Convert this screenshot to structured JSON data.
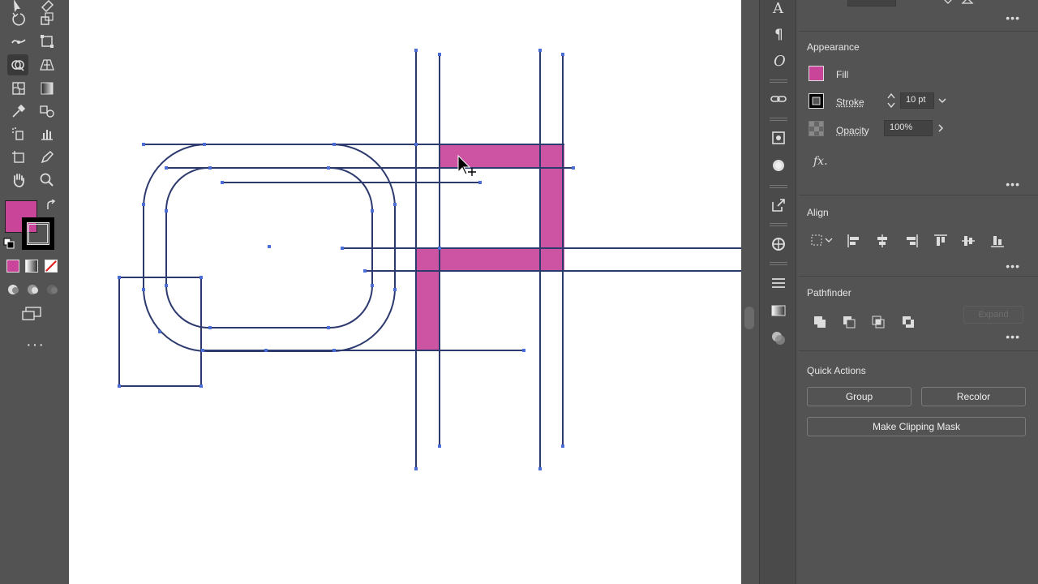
{
  "toolbar": {
    "colors": {
      "fill": "#c8459a",
      "stroke": "#000000"
    }
  },
  "panel": {
    "appearance": {
      "title": "Appearance",
      "fill_label": "Fill",
      "fill_color": "#c8459a",
      "stroke_label": "Stroke",
      "stroke_value": "10 pt",
      "opacity_label": "Opacity",
      "opacity_value": "100%",
      "fx_label": "fx."
    },
    "align": {
      "title": "Align"
    },
    "pathfinder": {
      "title": "Pathfinder",
      "expand_label": "Expand"
    },
    "quick_actions": {
      "title": "Quick Actions",
      "group_label": "Group",
      "recolor_label": "Recolor",
      "clipping_label": "Make Clipping Mask"
    }
  },
  "canvas": {
    "selection_color": "#4b6fd6",
    "path_color": "#2d3a6e",
    "highlight_color": "#c8459a"
  }
}
